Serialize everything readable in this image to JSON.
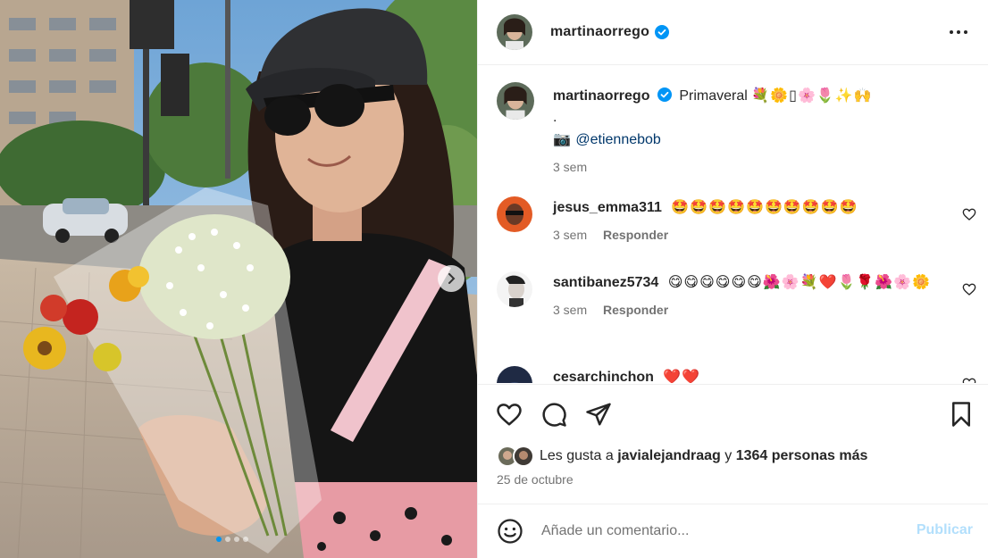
{
  "post": {
    "author": "martinaorrego",
    "caption_username": "martinaorrego",
    "caption_text": "Primaveral",
    "caption_emojis": "💐🌼▯🌸🌷✨🙌",
    "caption_dot": ".",
    "caption_camera": "📷",
    "caption_mention": "@etiennebob",
    "caption_time": "3 sem"
  },
  "comments": [
    {
      "username": "jesus_emma311",
      "text": "🤩🤩🤩🤩🤩🤩🤩🤩🤩🤩",
      "time": "3 sem",
      "reply": "Responder"
    },
    {
      "username": "santibanez5734",
      "text": "😋😋😋😋😋😋🌺🌸💐❤️🌷🌹🌺🌸🌼",
      "time": "3 sem",
      "reply": "Responder"
    },
    {
      "username": "cesarchinchon",
      "text": "❤️❤️"
    }
  ],
  "likes": {
    "prefix": "Les gusta a",
    "user": "javialejandraag",
    "joiner": "y",
    "others": "1364 personas más"
  },
  "date": "25 de octubre",
  "add_comment": {
    "placeholder": "Añade un comentario...",
    "publish": "Publicar"
  },
  "carousel": {
    "count": 4,
    "active": 0
  },
  "colors": {
    "verified": "#0095f6",
    "publish_disabled": "#b2dffc",
    "muted": "#737373"
  }
}
